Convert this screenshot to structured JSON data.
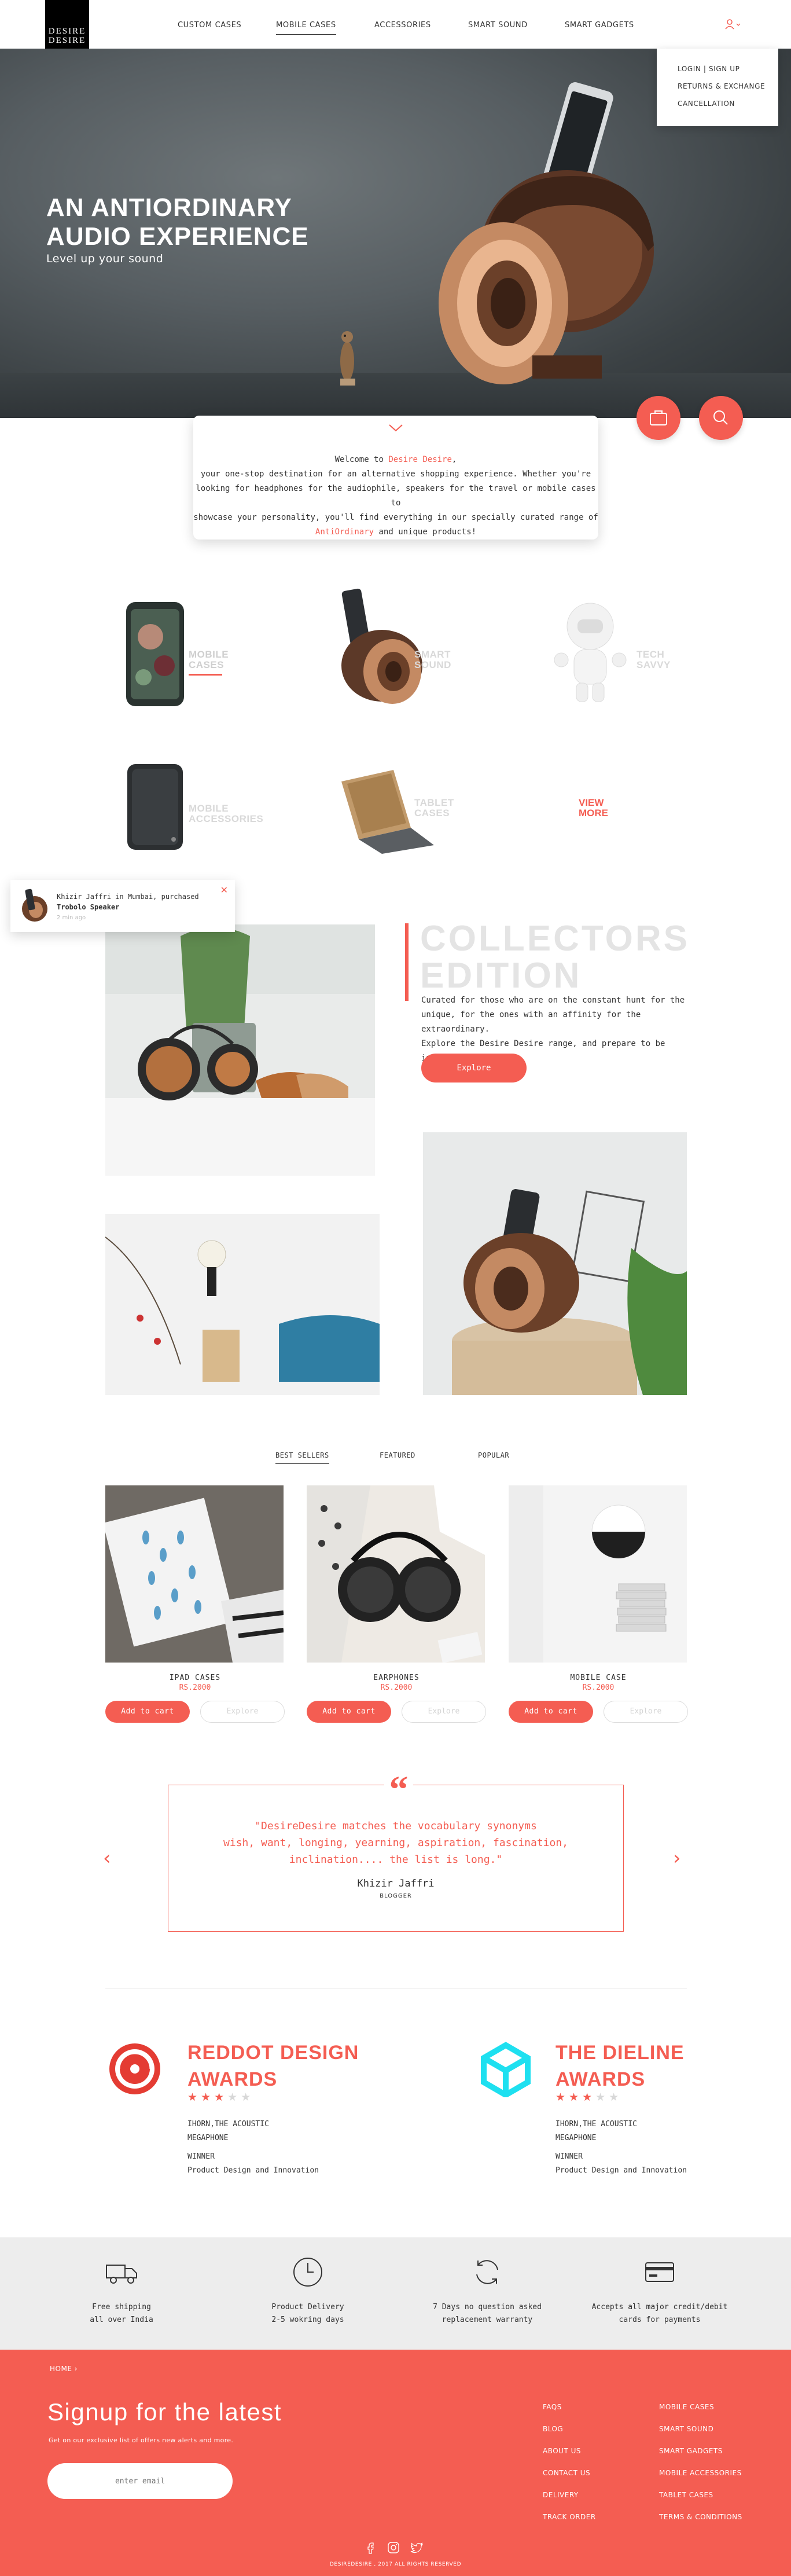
{
  "brand": {
    "logo_line1": "DESIRE",
    "logo_line2": "DESIRE"
  },
  "nav": {
    "items": [
      "CUSTOM CASES",
      "MOBILE CASES",
      "ACCESSORIES",
      "SMART SOUND",
      "SMART GADGETS"
    ],
    "active": "MOBILE CASES"
  },
  "account_menu": {
    "items": [
      "LOGIN | SIGN UP",
      "RETURNS & EXCHANGE",
      "CANCELLATION"
    ]
  },
  "hero": {
    "title_line1": "AN ANTIORDINARY",
    "title_line2": "AUDIO EXPERIENCE",
    "subtitle": "Level up your sound"
  },
  "welcome": {
    "pre": "Welcome to ",
    "brand": "Desire Desire",
    "post": ",",
    "line2": "your one-stop destination for an alternative shopping experience. Whether you're",
    "line3": "looking for headphones for the audiophile, speakers for the travel or mobile cases to",
    "line4": "showcase your personality, you'll find everything in our specially curated range  of",
    "highlight": "AntiOrdinary",
    "line5_post": " and unique products!"
  },
  "categories": {
    "items": [
      {
        "line1": "MOBILE",
        "line2": "CASES"
      },
      {
        "line1": "SMART",
        "line2": "SOUND"
      },
      {
        "line1": "TECH",
        "line2": "SAVVY"
      },
      {
        "line1": "MOBILE",
        "line2": "ACCESSORIES"
      },
      {
        "line1": "TABLET",
        "line2": "CASES"
      }
    ],
    "view_more_line1": "VIEW",
    "view_more_line2": "MORE"
  },
  "toast": {
    "line1": "Khizir Jaffri in Mumbai, purchased",
    "line2": "Trobolo Speaker",
    "time": "2 min ago"
  },
  "collectors": {
    "title_line1": "COLLECTORS",
    "title_line2": "EDITION",
    "desc_line1": "Curated for those who are on the constant hunt for the",
    "desc_line2": "unique, for the ones with an affinity for the extraordinary.",
    "desc_line3": "Explore the Desire Desire range, and prepare to be inspired.",
    "button": "Explore"
  },
  "product_tabs": [
    "BEST SELLERS",
    "FEATURED",
    "POPULAR"
  ],
  "products": [
    {
      "name": "IPAD CASES",
      "price": "RS.2000",
      "cart": "Add to cart",
      "explore": "Explore"
    },
    {
      "name": "EARPHONES",
      "price": "RS.2000",
      "cart": "Add to cart",
      "explore": "Explore"
    },
    {
      "name": "MOBILE CASE",
      "price": "RS.2000",
      "cart": "Add to cart",
      "explore": "Explore"
    }
  ],
  "testimonial": {
    "line1": "\"DesireDesire matches the vocabulary synonyms",
    "line2": "wish, want, longing, yearning, aspiration, fascination,",
    "line3": "inclination.... the list is long.\"",
    "author": "Khizir Jaffri",
    "role": "BLOGGER"
  },
  "awards": [
    {
      "title_line1": "REDDOT DESIGN",
      "title_line2": "AWARDS",
      "stars": 3,
      "product_line1": "IHORN,THE ACOUSTIC",
      "product_line2": "MEGAPHONE",
      "status": "WINNER",
      "category": "Product Design and Innovation"
    },
    {
      "title_line1": "THE DIELINE",
      "title_line2": "AWARDS",
      "stars": 3,
      "product_line1": "IHORN,THE ACOUSTIC",
      "product_line2": "MEGAPHONE",
      "status": "WINNER",
      "category": "Product Design and Innovation"
    }
  ],
  "features": [
    {
      "icon": "truck-icon",
      "line1": "Free shipping",
      "line2": "all over India"
    },
    {
      "icon": "clock-icon",
      "line1": "Product Delivery",
      "line2": "2-5 wokring days"
    },
    {
      "icon": "refresh-icon",
      "line1": "7 Days no question asked",
      "line2": "replacement warranty"
    },
    {
      "icon": "credit-card-icon",
      "line1": "Accepts all major credit/debit",
      "line2": "cards for payments"
    }
  ],
  "footer": {
    "breadcrumb": "HOME  ›",
    "signup_title": "Signup for the latest",
    "signup_sub": "Get on our exclusive list of offers new alerts and more.",
    "email_placeholder": "enter email",
    "links_col1": [
      "FAQS",
      "BLOG",
      "ABOUT US",
      "CONTACT US",
      "DELIVERY",
      "TRACK ORDER"
    ],
    "links_col2": [
      "MOBILE CASES",
      "SMART SOUND",
      "SMART GADGETS",
      "MOBILE ACCESSORIES",
      "TABLET CASES",
      "TERMS & CONDITIONS"
    ],
    "copyright": "DESIREDESIRE , 2017 ALL RIGHTS RESERVED"
  },
  "colors": {
    "accent": "#f45d52",
    "footer_bg": "#f45d52",
    "features_bg": "#ededed",
    "hero_bg": "#575e62"
  }
}
